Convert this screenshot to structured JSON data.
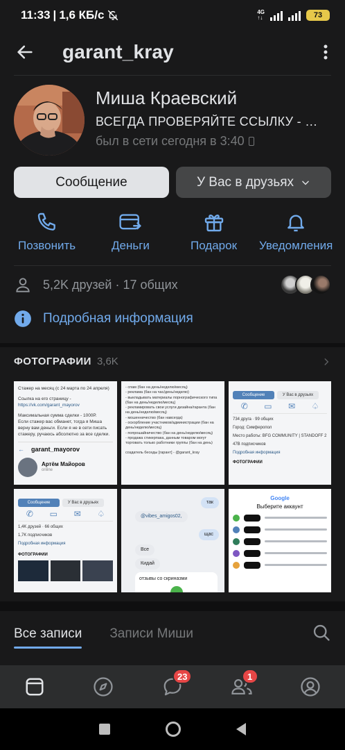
{
  "status_bar": {
    "time": "11:33",
    "speed": "1,6 КБ/с",
    "network": "4G",
    "battery": "73"
  },
  "header": {
    "title": "garant_kray"
  },
  "profile": {
    "name": "Миша Краевский",
    "status": "ВСЕГДА ПРОВЕРЯЙТЕ ССЫЛКУ - @garant_kray",
    "online": "был в сети сегодня в 3:40"
  },
  "buttons": {
    "message": "Сообщение",
    "friends": "У Вас в друзьях"
  },
  "actions": [
    {
      "label": "Позвонить",
      "icon": "phone-icon"
    },
    {
      "label": "Деньги",
      "icon": "money-transfer-icon"
    },
    {
      "label": "Подарок",
      "icon": "gift-icon"
    },
    {
      "label": "Уведомления",
      "icon": "bell-icon"
    }
  ],
  "friends": {
    "text": "5,2K друзей · 17 общих"
  },
  "info": {
    "text": "Подробная информация"
  },
  "photos": {
    "title": "ФОТОГРАФИИ",
    "count": "3,6K",
    "items": [
      {
        "line1": "Стажер на месяц (с 24 марта по 24 апреля)",
        "line2": "Ссылка на его страницу -",
        "link": "https://vk.com/garant_mayorov",
        "line3": "Максимальная сумма сделки - 1000Р.",
        "line4": "Если стажер вас обманет, тогда я Миша верну вам деньги. Если я не в сети писать стажеру, ручаюсь абсолютно за все сделки.",
        "handle": "garant_mayorov",
        "name": "Артём Майоров",
        "sub": "online"
      },
      {
        "lines": [
          "- спам (бан на день/неделю/месяц)",
          "- реклама (бан на час/день/неделю)",
          "- выкладывать материалы порнографического типа (бан на день/неделю/месяц)",
          "- рекламировать свои услуги дизайна/гаранта (бан на день/неделю/месяц)",
          "- мошенничество (бан навсегда)",
          "- оскорбление участников/администрации (бан на день/неделю/месяц)",
          "- попрошайничество (бан на день/неделю/месяц)",
          "- продажа стикерпака, данным товаром могут торговать только работники группы (бан на день)",
          "создатель беседы [гарант] - @garant_kray"
        ]
      },
      {
        "msg_btn": "Сообщение",
        "friend_btn": "У Вас в друзьях",
        "friends": "734 друга · 99 общих",
        "city": "Город: Симферопол",
        "work": "Место работы: BFG COMMUNITY | STANDOFF 2",
        "subs": "47В подписчиков",
        "info": "Подробная информация",
        "photos": "ФОТОГРАФИИ"
      },
      {
        "msg_btn": "Сообщение",
        "friend_btn": "У Вас в друзьях",
        "friends": "1,4K друзей · 66 общих",
        "subs": "1,7K подписчиков",
        "info": "Подробная информация",
        "photos": "ФОТОГРАФИИ"
      },
      {
        "b1": "так",
        "b2": "@vibes_amigos02,",
        "b3": "щас",
        "b4": "Все",
        "b5": "Кидай",
        "b6": "отзывы со скриназми"
      },
      {
        "brand": "Google",
        "heading": "Выберите аккаунт"
      }
    ]
  },
  "tabs": {
    "all_posts": "Все записи",
    "misha_posts": "Записи Миши"
  },
  "tabbar": {
    "messages_badge": "23",
    "friends_badge": "1"
  },
  "colors": {
    "background": "#19191a",
    "accent": "#71aaeb",
    "badge": "#e64646"
  }
}
